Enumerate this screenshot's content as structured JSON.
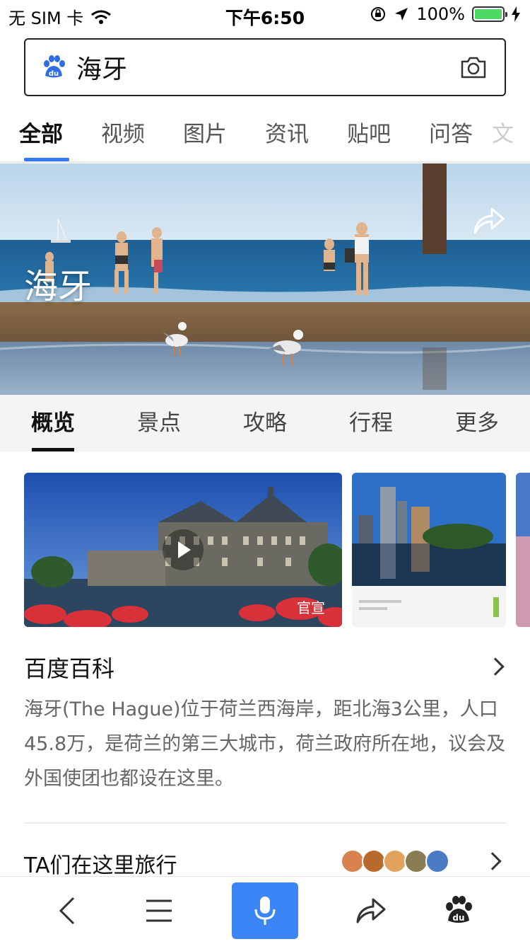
{
  "status_bar": {
    "carrier": "无 SIM 卡",
    "time": "下午6:50",
    "battery_percent": "100%",
    "battery_level": 1.0,
    "battery_color": "#4cd964"
  },
  "search": {
    "query": "海牙",
    "logo_text": "du"
  },
  "category_tabs": [
    "全部",
    "视频",
    "图片",
    "资讯",
    "贴吧",
    "问答",
    "文"
  ],
  "hero": {
    "title": "海牙"
  },
  "sub_tabs": [
    "概览",
    "景点",
    "攻略",
    "行程",
    "更多"
  ],
  "gallery": {
    "official_label": "官宣"
  },
  "baike": {
    "title": "百度百科",
    "description": "海牙(The Hague)位于荷兰西海岸，距北海3公里，人口45.8万，是荷兰的第三大城市，荷兰政府所在地，议会及外国使团也都设在这里。"
  },
  "travelers": {
    "title": "TA们在这里旅行"
  },
  "bottom_bar": {
    "logo_text": "du"
  },
  "colors": {
    "accent": "#3478f6",
    "mic_button": "#3b86f7"
  }
}
